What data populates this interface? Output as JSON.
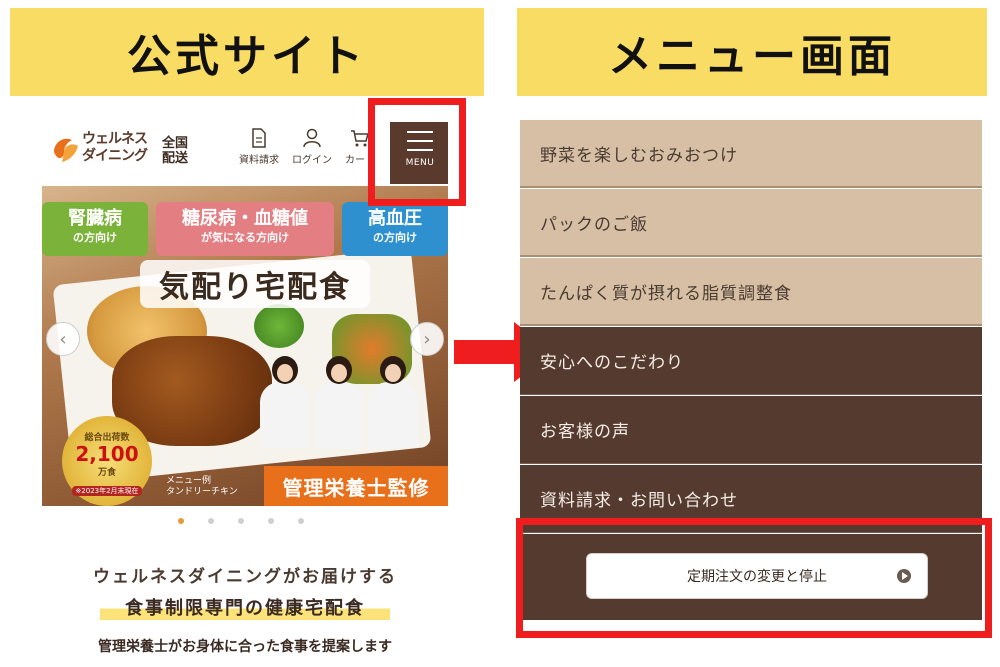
{
  "banners": {
    "left_title": "公式サイト",
    "right_title": "メニュー画面"
  },
  "site": {
    "logo_text_line1": "ウェルネス",
    "logo_text_line2": "ダイニング",
    "zenkoku_line1": "全国",
    "zenkoku_line2": "配送",
    "header_buttons": {
      "document": "資料請求",
      "login": "ログイン",
      "cart": "カート"
    },
    "menu_label": "MENU",
    "hero": {
      "tag_kidney_main": "腎臓病",
      "tag_kidney_sub": "の方向け",
      "tag_diabetes_main": "糖尿病・血糖値",
      "tag_diabetes_sub": "が気になる方向け",
      "tag_bp_main": "高血圧",
      "tag_bp_sub": "の方向け",
      "headline": "気配り宅配食",
      "badge_line1": "総合出荷数",
      "badge_number": "2,100",
      "badge_unit": "万食",
      "badge_note": "※2023年2月末現在",
      "menu_note_line1": "メニュー例",
      "menu_note_line2": "タンドリーチキン",
      "supervision": "管理栄養士監修",
      "carousel_total": 5,
      "carousel_active": 1
    },
    "intro_line1": "ウェルネスダイニングがお届けする",
    "intro_line2": "食事制限専門の健康宅配食",
    "intro_line3": "管理栄養士がお身体に合った食事を提案します"
  },
  "menu_panel": {
    "items": [
      {
        "label": "野菜を楽しむおみおつけ"
      },
      {
        "label": "パックのご飯"
      },
      {
        "label": "たんぱく質が摂れる脂質調整食"
      },
      {
        "label": "安心へのこだわり"
      },
      {
        "label": "お客様の声"
      },
      {
        "label": "資料請求・お問い合わせ"
      }
    ],
    "order_button": "定期注文の変更と停止"
  },
  "colors": {
    "banner": "#f9dc63",
    "highlight_red": "#ef1d1d",
    "menu_light": "#d7bfa5",
    "menu_dark": "#553a30"
  }
}
